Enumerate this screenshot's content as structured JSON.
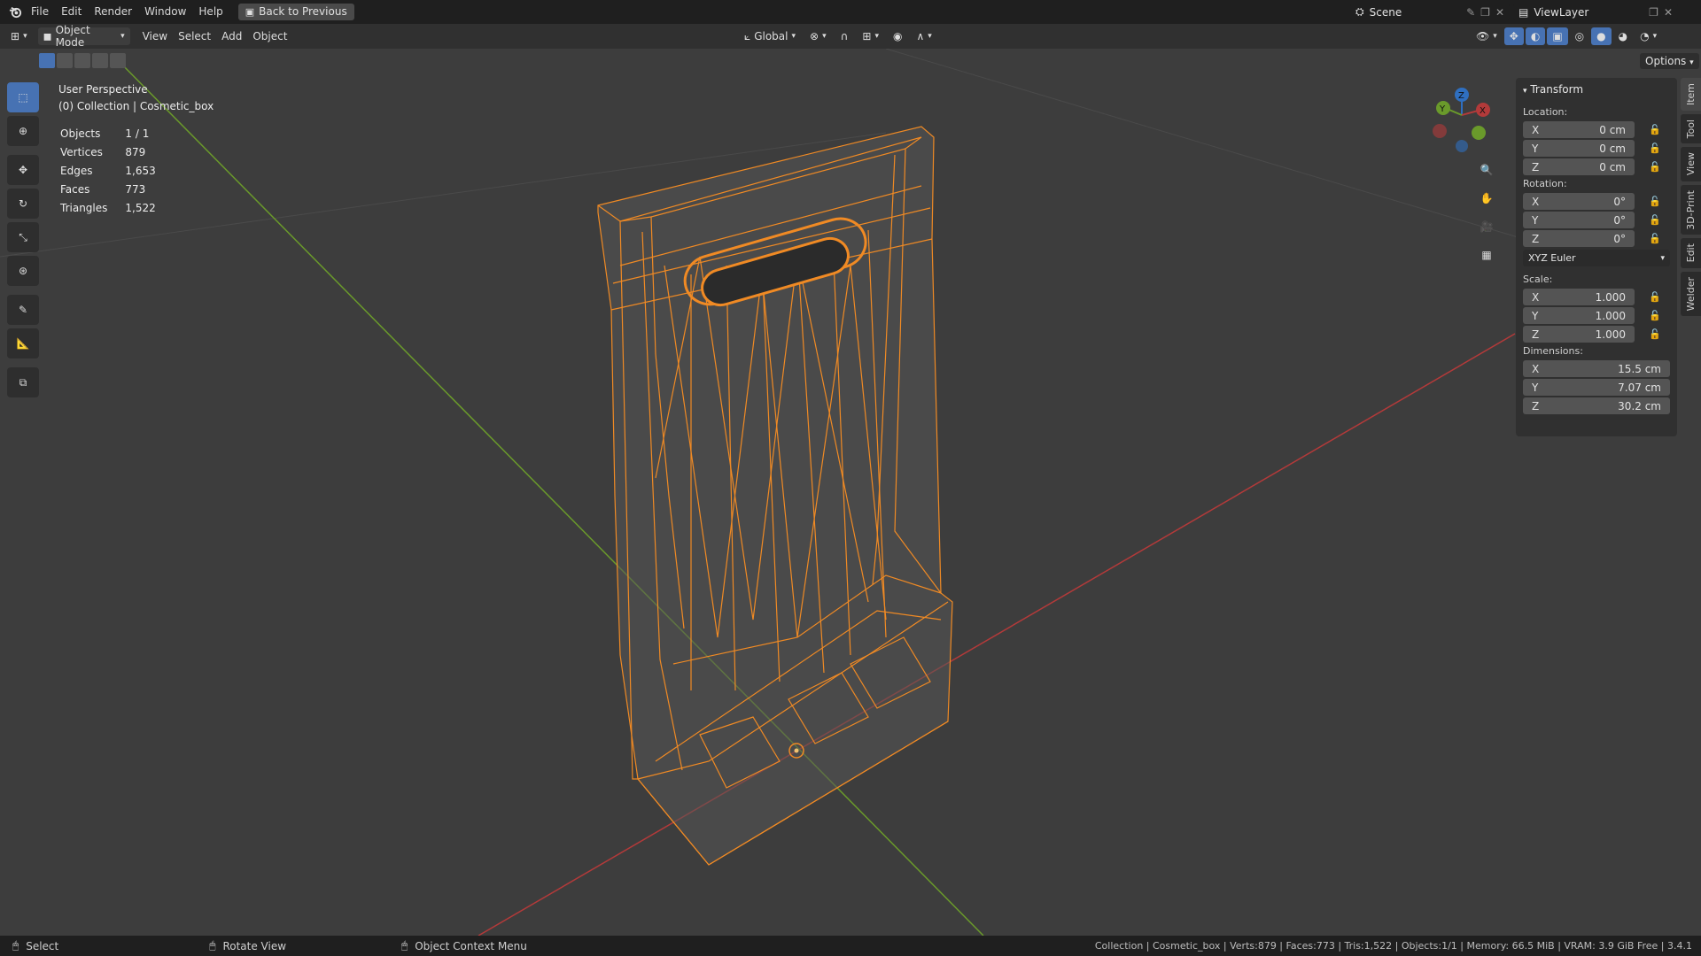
{
  "menubar": {
    "items": [
      "File",
      "Edit",
      "Render",
      "Window",
      "Help"
    ],
    "back_button": "Back to Previous",
    "scene": "Scene",
    "view_layer": "ViewLayer"
  },
  "header": {
    "mode": "Object Mode",
    "menus": [
      "View",
      "Select",
      "Add",
      "Object"
    ],
    "orientation": "Global",
    "options": "Options"
  },
  "viewport": {
    "title": "User Perspective",
    "collection": "(0) Collection | Cosmetic_box",
    "stats": [
      {
        "label": "Objects",
        "value": "1 / 1"
      },
      {
        "label": "Vertices",
        "value": "879"
      },
      {
        "label": "Edges",
        "value": "1,653"
      },
      {
        "label": "Faces",
        "value": "773"
      },
      {
        "label": "Triangles",
        "value": "1,522"
      }
    ]
  },
  "gizmo": {
    "x": "X",
    "y": "Y",
    "z": "Z"
  },
  "npanel": {
    "title": "Transform",
    "location_label": "Location:",
    "location": [
      {
        "axis": "X",
        "value": "0 cm"
      },
      {
        "axis": "Y",
        "value": "0 cm"
      },
      {
        "axis": "Z",
        "value": "0 cm"
      }
    ],
    "rotation_label": "Rotation:",
    "rotation": [
      {
        "axis": "X",
        "value": "0°"
      },
      {
        "axis": "Y",
        "value": "0°"
      },
      {
        "axis": "Z",
        "value": "0°"
      }
    ],
    "rotation_mode": "XYZ Euler",
    "scale_label": "Scale:",
    "scale": [
      {
        "axis": "X",
        "value": "1.000"
      },
      {
        "axis": "Y",
        "value": "1.000"
      },
      {
        "axis": "Z",
        "value": "1.000"
      }
    ],
    "dimensions_label": "Dimensions:",
    "dimensions": [
      {
        "axis": "X",
        "value": "15.5 cm"
      },
      {
        "axis": "Y",
        "value": "7.07 cm"
      },
      {
        "axis": "Z",
        "value": "30.2 cm"
      }
    ],
    "tabs": [
      "Item",
      "Tool",
      "View",
      "3D-Print",
      "Edit",
      "Welder"
    ]
  },
  "statusbar": {
    "select": "Select",
    "rotate": "Rotate View",
    "context": "Object Context Menu",
    "info": "Collection | Cosmetic_box | Verts:879 | Faces:773 | Tris:1,522 | Objects:1/1 | Memory: 66.5 MiB | VRAM: 3.9 GiB Free | 3.4.1"
  },
  "colors": {
    "accent": "#4772b3",
    "wire": "#f08a24",
    "x_axis": "#b33a3a",
    "y_axis": "#6a9a2b"
  }
}
